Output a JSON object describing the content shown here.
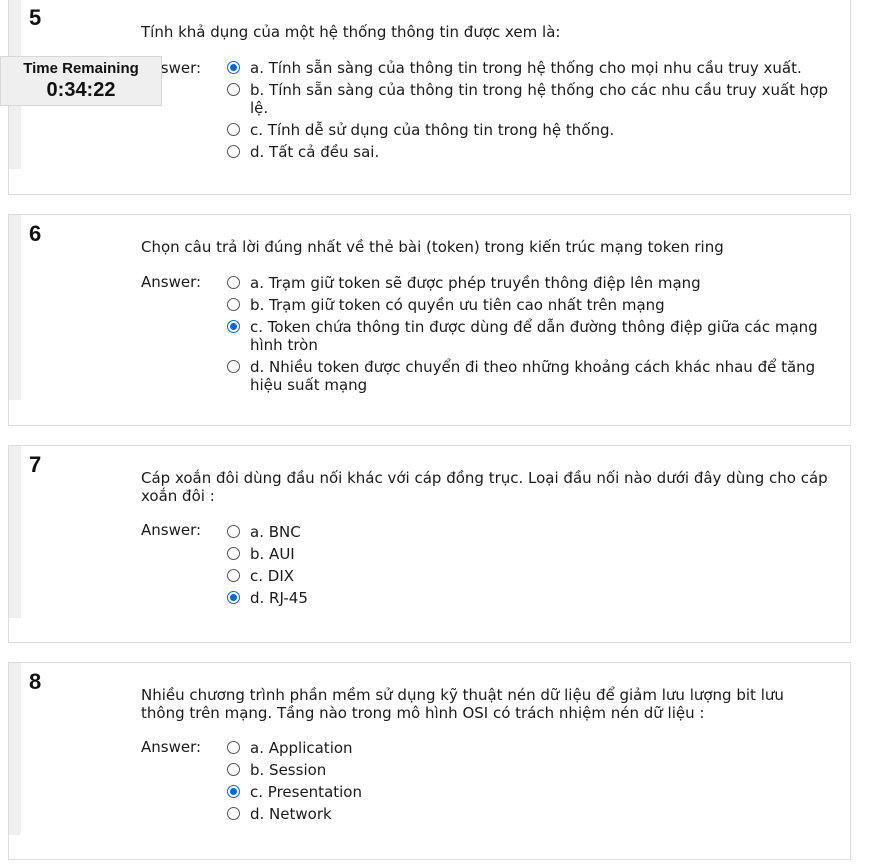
{
  "timer": {
    "label": "Time Remaining",
    "value": "0:34:22"
  },
  "answer_label": "Answer:",
  "questions": [
    {
      "number": "5",
      "text": "Tính khả dụng của một hệ thống thông tin được xem là:",
      "options": [
        "a. Tính sẵn sàng của thông tin trong hệ thống cho mọi nhu cầu truy xuất.",
        "b. Tính sẵn sàng của thông tin trong hệ thống cho các nhu cầu truy xuất hợp lệ.",
        "c. Tính dễ sử dụng của thông tin trong hệ thống.",
        "d. Tất cả đều sai."
      ],
      "selected_option": "a. Tính sẵn sàng của thông tin trong hệ thống cho mọi nhu cầu truy xuất."
    },
    {
      "number": "6",
      "text": "Chọn câu trả lời đúng nhất về thẻ bài (token) trong kiến trúc mạng token ring",
      "options": [
        "a. Trạm giữ token sẽ được phép truyền thông điệp lên mạng",
        "b. Trạm giữ token có quyền ưu tiên cao nhất trên mạng",
        "c. Token chứa thông tin được dùng để dẫn đường thông điệp giữa các mạng hình tròn",
        "d. Nhiều token được chuyển đi theo những khoảng cách khác nhau để tăng hiệu suất mạng"
      ],
      "selected_option": "c. Token chứa thông tin được dùng để dẫn đường thông điệp giữa các mạng hình tròn"
    },
    {
      "number": "7",
      "text": "Cáp xoắn đôi dùng đầu nối khác với cáp đồng trục. Loại đầu nối nào dưới đây dùng cho cáp xoắn đôi :",
      "options": [
        "a. BNC",
        "b. AUI",
        "c. DIX",
        "d. RJ-45"
      ],
      "selected_option": "d. RJ-45"
    },
    {
      "number": "8",
      "text": "Nhiều chương trình phần mềm sử dụng kỹ thuật nén dữ liệu để giảm lưu lượng bit lưu thông trên mạng. Tầng nào trong mô hình OSI có trách nhiệm nén dữ liệu :",
      "options": [
        "a. Application",
        "b. Session",
        "c. Presentation",
        "d. Network"
      ],
      "selected_option": "c. Presentation"
    }
  ]
}
